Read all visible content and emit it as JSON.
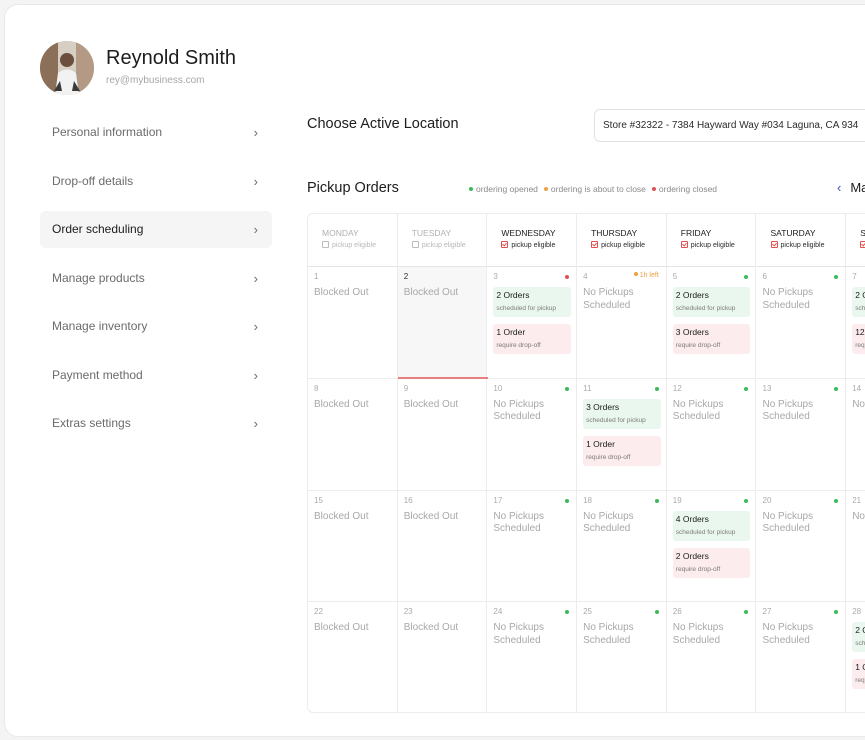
{
  "profile": {
    "name": "Reynold Smith",
    "email": "rey@mybusiness.com"
  },
  "sidebar": {
    "items": [
      {
        "label": "Personal information",
        "active": false
      },
      {
        "label": "Drop-off details",
        "active": false
      },
      {
        "label": "Order scheduling",
        "active": true
      },
      {
        "label": "Manage products",
        "active": false
      },
      {
        "label": "Manage inventory",
        "active": false
      },
      {
        "label": "Payment method",
        "active": false
      },
      {
        "label": "Extras settings",
        "active": false
      }
    ],
    "chevron": ">"
  },
  "location": {
    "title": "Choose Active Location",
    "value": "Store #32322 - 7384 Hayward Way #034 Laguna, CA 934"
  },
  "pickup": {
    "title": "Pickup Orders",
    "legend": [
      {
        "label": "ordering opened",
        "color": "#3dbb5a"
      },
      {
        "label": "ordering is about to close",
        "color": "#f0a040"
      },
      {
        "label": "ordering closed",
        "color": "#e05252"
      }
    ],
    "prev_icon": "chevron-left-icon",
    "month_label": "Ma"
  },
  "colors": {
    "opened": "#3dbb5a",
    "closing": "#f0a040",
    "closed": "#e05252",
    "today_underline": "#e87f7f"
  },
  "calendar": {
    "days": [
      {
        "name": "MONDAY",
        "eligible_label": "pickup eligible",
        "eligible": false
      },
      {
        "name": "TUESDAY",
        "eligible_label": "pickup eligible",
        "eligible": false
      },
      {
        "name": "WEDNESDAY",
        "eligible_label": "pickup eligible",
        "eligible": true
      },
      {
        "name": "THURSDAY",
        "eligible_label": "pickup eligible",
        "eligible": true
      },
      {
        "name": "FRIDAY",
        "eligible_label": "pickup eligible",
        "eligible": true
      },
      {
        "name": "SATURDAY",
        "eligible_label": "pickup eligible",
        "eligible": true
      },
      {
        "name": "SUNDAY",
        "eligible_label": "pickup eligible",
        "eligible": true
      }
    ],
    "weeks": [
      [
        {
          "num": "1",
          "text": "Blocked Out"
        },
        {
          "num": "2",
          "text": "Blocked Out",
          "today": true
        },
        {
          "num": "3",
          "status": "closed",
          "orders": [
            {
              "kind": "green",
              "t1": "2 Orders",
              "t2": "scheduled for pickup"
            },
            {
              "kind": "red",
              "t1": "1 Order",
              "t2": "require drop-off"
            }
          ]
        },
        {
          "num": "4",
          "status": "closing",
          "note": "1h left",
          "text": "No Pickups Scheduled"
        },
        {
          "num": "5",
          "status": "opened",
          "orders": [
            {
              "kind": "green",
              "t1": "2 Orders",
              "t2": "scheduled for pickup"
            },
            {
              "kind": "red",
              "t1": "3 Orders",
              "t2": "require drop-off"
            }
          ]
        },
        {
          "num": "6",
          "status": "opened",
          "text": "No Pickups Scheduled"
        },
        {
          "num": "7",
          "orders": [
            {
              "kind": "green",
              "t1": "2 O",
              "t2": "sche"
            },
            {
              "kind": "red",
              "t1": "12 O",
              "t2": "requ"
            }
          ]
        }
      ],
      [
        {
          "num": "8",
          "text": "Blocked Out"
        },
        {
          "num": "9",
          "text": "Blocked Out"
        },
        {
          "num": "10",
          "status": "opened",
          "text": "No Pickups Scheduled"
        },
        {
          "num": "11",
          "status": "opened",
          "orders": [
            {
              "kind": "green",
              "t1": "3 Orders",
              "t2": "scheduled for pickup"
            },
            {
              "kind": "red",
              "t1": "1 Order",
              "t2": "require drop-off"
            }
          ]
        },
        {
          "num": "12",
          "status": "opened",
          "text": "No Pickups Scheduled"
        },
        {
          "num": "13",
          "status": "opened",
          "text": "No Pickups Scheduled"
        },
        {
          "num": "14",
          "text": "No Sch"
        }
      ],
      [
        {
          "num": "15",
          "text": "Blocked Out"
        },
        {
          "num": "16",
          "text": "Blocked Out"
        },
        {
          "num": "17",
          "status": "opened",
          "text": "No Pickups Scheduled"
        },
        {
          "num": "18",
          "status": "opened",
          "text": "No Pickups Scheduled"
        },
        {
          "num": "19",
          "status": "opened",
          "orders": [
            {
              "kind": "green",
              "t1": "4 Orders",
              "t2": "scheduled for pickup"
            },
            {
              "kind": "red",
              "t1": "2 Orders",
              "t2": "require drop-off"
            }
          ]
        },
        {
          "num": "20",
          "status": "opened",
          "text": "No Pickups Scheduled"
        },
        {
          "num": "21",
          "text": "No Sch"
        }
      ],
      [
        {
          "num": "22",
          "text": "Blocked Out"
        },
        {
          "num": "23",
          "text": "Blocked Out"
        },
        {
          "num": "24",
          "status": "opened",
          "text": "No Pickups Scheduled"
        },
        {
          "num": "25",
          "status": "opened",
          "text": "No Pickups Scheduled"
        },
        {
          "num": "26",
          "status": "opened",
          "text": "No Pickups Scheduled"
        },
        {
          "num": "27",
          "status": "opened",
          "text": "No Pickups Scheduled"
        },
        {
          "num": "28",
          "orders": [
            {
              "kind": "green",
              "t1": "2 O",
              "t2": "sche"
            },
            {
              "kind": "red",
              "t1": "1 O",
              "t2": "requ"
            }
          ]
        }
      ]
    ]
  }
}
